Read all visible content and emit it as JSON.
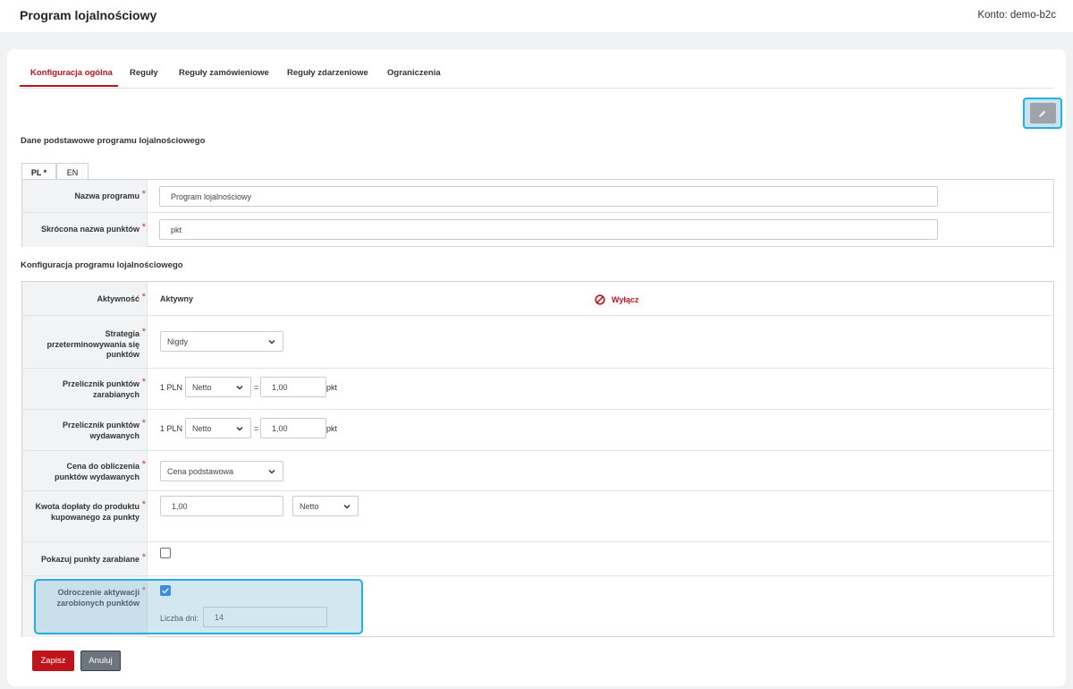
{
  "header": {
    "title": "Program lojalnościowy",
    "account": "Konto: demo-b2c"
  },
  "tabs": [
    {
      "label": "Konfiguracja ogólna",
      "active": true
    },
    {
      "label": "Reguły"
    },
    {
      "label": "Reguły zamówieniowe"
    },
    {
      "label": "Reguły zdarzeniowe"
    },
    {
      "label": "Ograniczenia"
    }
  ],
  "section_basic": {
    "title": "Dane podstawowe programu lojalnościowego",
    "lang_tabs": [
      "PL *",
      "EN"
    ],
    "fields": [
      {
        "label": "Nazwa programu",
        "value": "Program lojalnościowy"
      },
      {
        "label": "Skrócona nazwa punktów",
        "value": "pkt"
      }
    ]
  },
  "section_config": {
    "title": "Konfiguracja programu lojalnościowego",
    "activity": {
      "label": "Aktywność",
      "value": "Aktywny",
      "action": "Wyłącz"
    },
    "expiry": {
      "label": "Strategia przeterminowywania się punktów",
      "value": "Nigdy"
    },
    "earned_rate": {
      "label": "Przelicznik punktów zarabianych",
      "prefix": "1 PLN",
      "type": "Netto",
      "eq": "=",
      "value": "1,00",
      "unit": "pkt"
    },
    "spent_rate": {
      "label": "Przelicznik punktów wydawanych",
      "prefix": "1 PLN",
      "type": "Netto",
      "eq": "=",
      "value": "1,00",
      "unit": "pkt"
    },
    "price": {
      "label": "Cena do obliczenia punktów wydawanych",
      "value": "Cena podstawowa"
    },
    "surcharge": {
      "label": "Kwota dopłaty do produktu kupowanego za punkty",
      "value": "1,00",
      "type": "Netto"
    },
    "show_points": {
      "label": "Pokazuj punkty zarabiane",
      "checked": false
    },
    "delay": {
      "label": "Odroczenie aktywacji zarobionych punktów",
      "checked": true,
      "days_label": "Liczba dni:",
      "days_value": "14"
    }
  },
  "actions": {
    "save": "Zapisz",
    "cancel": "Anuluj"
  },
  "colors": {
    "accent": "#c0141d",
    "highlight": "#25aee4",
    "cancel": "#6c757d"
  }
}
